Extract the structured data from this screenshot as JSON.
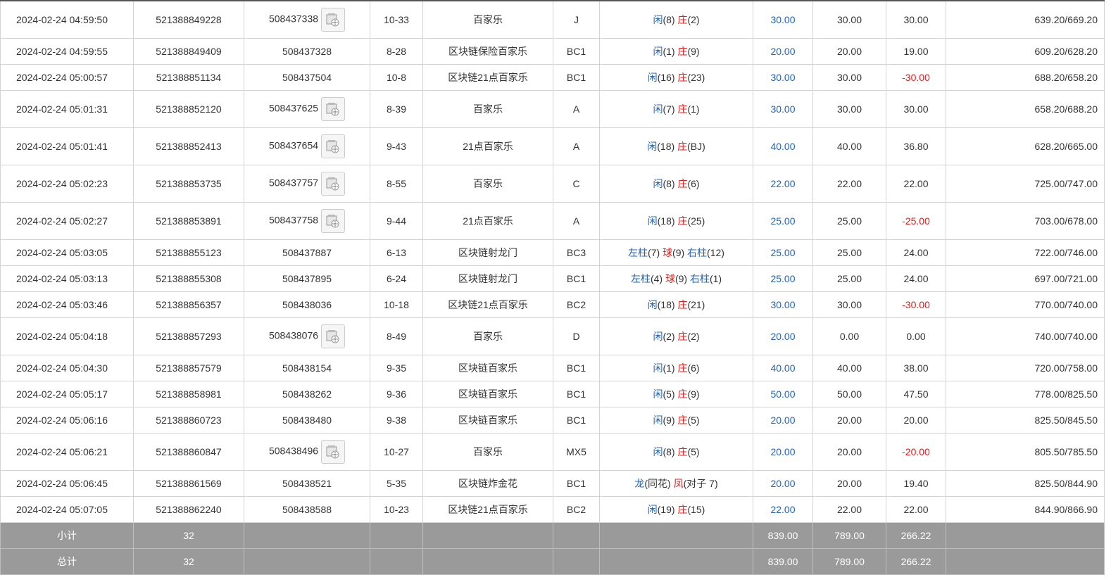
{
  "rows": [
    {
      "time": "2024-02-24 04:59:50",
      "bet_id": "521388849228",
      "round_id": "508437338",
      "video": true,
      "shoe": "10-33",
      "game": "百家乐",
      "table": "J",
      "result": [
        {
          "t": "闲",
          "c": "blue"
        },
        {
          "t": "(8) ",
          "c": ""
        },
        {
          "t": "庄",
          "c": "red"
        },
        {
          "t": "(2)",
          "c": ""
        }
      ],
      "bet": "30.00",
      "valid": "30.00",
      "win": "30.00",
      "win_neg": false,
      "balance": "639.20/669.20"
    },
    {
      "time": "2024-02-24 04:59:55",
      "bet_id": "521388849409",
      "round_id": "508437328",
      "video": false,
      "shoe": "8-28",
      "game": "区块链保险百家乐",
      "table": "BC1",
      "result": [
        {
          "t": "闲",
          "c": "blue"
        },
        {
          "t": "(1) ",
          "c": ""
        },
        {
          "t": "庄",
          "c": "red"
        },
        {
          "t": "(9)",
          "c": ""
        }
      ],
      "bet": "20.00",
      "valid": "20.00",
      "win": "19.00",
      "win_neg": false,
      "balance": "609.20/628.20"
    },
    {
      "time": "2024-02-24 05:00:57",
      "bet_id": "521388851134",
      "round_id": "508437504",
      "video": false,
      "shoe": "10-8",
      "game": "区块链21点百家乐",
      "table": "BC1",
      "result": [
        {
          "t": "闲",
          "c": "blue"
        },
        {
          "t": "(16) ",
          "c": ""
        },
        {
          "t": "庄",
          "c": "red"
        },
        {
          "t": "(23)",
          "c": ""
        }
      ],
      "bet": "30.00",
      "valid": "30.00",
      "win": "-30.00",
      "win_neg": true,
      "balance": "688.20/658.20"
    },
    {
      "time": "2024-02-24 05:01:31",
      "bet_id": "521388852120",
      "round_id": "508437625",
      "video": true,
      "shoe": "8-39",
      "game": "百家乐",
      "table": "A",
      "result": [
        {
          "t": "闲",
          "c": "blue"
        },
        {
          "t": "(7) ",
          "c": ""
        },
        {
          "t": "庄",
          "c": "red"
        },
        {
          "t": "(1)",
          "c": ""
        }
      ],
      "bet": "30.00",
      "valid": "30.00",
      "win": "30.00",
      "win_neg": false,
      "balance": "658.20/688.20"
    },
    {
      "time": "2024-02-24 05:01:41",
      "bet_id": "521388852413",
      "round_id": "508437654",
      "video": true,
      "shoe": "9-43",
      "game": "21点百家乐",
      "table": "A",
      "result": [
        {
          "t": "闲",
          "c": "blue"
        },
        {
          "t": "(18) ",
          "c": ""
        },
        {
          "t": "庄",
          "c": "red"
        },
        {
          "t": "(BJ)",
          "c": ""
        }
      ],
      "bet": "40.00",
      "valid": "40.00",
      "win": "36.80",
      "win_neg": false,
      "balance": "628.20/665.00"
    },
    {
      "time": "2024-02-24 05:02:23",
      "bet_id": "521388853735",
      "round_id": "508437757",
      "video": true,
      "shoe": "8-55",
      "game": "百家乐",
      "table": "C",
      "result": [
        {
          "t": "闲",
          "c": "blue"
        },
        {
          "t": "(8) ",
          "c": ""
        },
        {
          "t": "庄",
          "c": "red"
        },
        {
          "t": "(6)",
          "c": ""
        }
      ],
      "bet": "22.00",
      "valid": "22.00",
      "win": "22.00",
      "win_neg": false,
      "balance": "725.00/747.00"
    },
    {
      "time": "2024-02-24 05:02:27",
      "bet_id": "521388853891",
      "round_id": "508437758",
      "video": true,
      "shoe": "9-44",
      "game": "21点百家乐",
      "table": "A",
      "result": [
        {
          "t": "闲",
          "c": "blue"
        },
        {
          "t": "(18) ",
          "c": ""
        },
        {
          "t": "庄",
          "c": "red"
        },
        {
          "t": "(25)",
          "c": ""
        }
      ],
      "bet": "25.00",
      "valid": "25.00",
      "win": "-25.00",
      "win_neg": true,
      "balance": "703.00/678.00"
    },
    {
      "time": "2024-02-24 05:03:05",
      "bet_id": "521388855123",
      "round_id": "508437887",
      "video": false,
      "shoe": "6-13",
      "game": "区块链射龙门",
      "table": "BC3",
      "result": [
        {
          "t": "左柱",
          "c": "blue"
        },
        {
          "t": "(7) ",
          "c": ""
        },
        {
          "t": "球",
          "c": "red"
        },
        {
          "t": "(9) ",
          "c": ""
        },
        {
          "t": "右柱",
          "c": "blue"
        },
        {
          "t": "(12)",
          "c": ""
        }
      ],
      "bet": "25.00",
      "valid": "25.00",
      "win": "24.00",
      "win_neg": false,
      "balance": "722.00/746.00"
    },
    {
      "time": "2024-02-24 05:03:13",
      "bet_id": "521388855308",
      "round_id": "508437895",
      "video": false,
      "shoe": "6-24",
      "game": "区块链射龙门",
      "table": "BC1",
      "result": [
        {
          "t": "左柱",
          "c": "blue"
        },
        {
          "t": "(4) ",
          "c": ""
        },
        {
          "t": "球",
          "c": "red"
        },
        {
          "t": "(9) ",
          "c": ""
        },
        {
          "t": "右柱",
          "c": "blue"
        },
        {
          "t": "(1)",
          "c": ""
        }
      ],
      "bet": "25.00",
      "valid": "25.00",
      "win": "24.00",
      "win_neg": false,
      "balance": "697.00/721.00"
    },
    {
      "time": "2024-02-24 05:03:46",
      "bet_id": "521388856357",
      "round_id": "508438036",
      "video": false,
      "shoe": "10-18",
      "game": "区块链21点百家乐",
      "table": "BC2",
      "result": [
        {
          "t": "闲",
          "c": "blue"
        },
        {
          "t": "(18) ",
          "c": ""
        },
        {
          "t": "庄",
          "c": "red"
        },
        {
          "t": "(21)",
          "c": ""
        }
      ],
      "bet": "30.00",
      "valid": "30.00",
      "win": "-30.00",
      "win_neg": true,
      "balance": "770.00/740.00"
    },
    {
      "time": "2024-02-24 05:04:18",
      "bet_id": "521388857293",
      "round_id": "508438076",
      "video": true,
      "shoe": "8-49",
      "game": "百家乐",
      "table": "D",
      "result": [
        {
          "t": "闲",
          "c": "blue"
        },
        {
          "t": "(2) ",
          "c": ""
        },
        {
          "t": "庄",
          "c": "red"
        },
        {
          "t": "(2)",
          "c": ""
        }
      ],
      "bet": "20.00",
      "valid": "0.00",
      "win": "0.00",
      "win_neg": false,
      "balance": "740.00/740.00"
    },
    {
      "time": "2024-02-24 05:04:30",
      "bet_id": "521388857579",
      "round_id": "508438154",
      "video": false,
      "shoe": "9-35",
      "game": "区块链百家乐",
      "table": "BC1",
      "result": [
        {
          "t": "闲",
          "c": "blue"
        },
        {
          "t": "(1) ",
          "c": ""
        },
        {
          "t": "庄",
          "c": "red"
        },
        {
          "t": "(6)",
          "c": ""
        }
      ],
      "bet": "40.00",
      "valid": "40.00",
      "win": "38.00",
      "win_neg": false,
      "balance": "720.00/758.00"
    },
    {
      "time": "2024-02-24 05:05:17",
      "bet_id": "521388858981",
      "round_id": "508438262",
      "video": false,
      "shoe": "9-36",
      "game": "区块链百家乐",
      "table": "BC1",
      "result": [
        {
          "t": "闲",
          "c": "blue"
        },
        {
          "t": "(5) ",
          "c": ""
        },
        {
          "t": "庄",
          "c": "red"
        },
        {
          "t": "(9)",
          "c": ""
        }
      ],
      "bet": "50.00",
      "valid": "50.00",
      "win": "47.50",
      "win_neg": false,
      "balance": "778.00/825.50"
    },
    {
      "time": "2024-02-24 05:06:16",
      "bet_id": "521388860723",
      "round_id": "508438480",
      "video": false,
      "shoe": "9-38",
      "game": "区块链百家乐",
      "table": "BC1",
      "result": [
        {
          "t": "闲",
          "c": "blue"
        },
        {
          "t": "(9) ",
          "c": ""
        },
        {
          "t": "庄",
          "c": "red"
        },
        {
          "t": "(5)",
          "c": ""
        }
      ],
      "bet": "20.00",
      "valid": "20.00",
      "win": "20.00",
      "win_neg": false,
      "balance": "825.50/845.50"
    },
    {
      "time": "2024-02-24 05:06:21",
      "bet_id": "521388860847",
      "round_id": "508438496",
      "video": true,
      "shoe": "10-27",
      "game": "百家乐",
      "table": "MX5",
      "result": [
        {
          "t": "闲",
          "c": "blue"
        },
        {
          "t": "(8) ",
          "c": ""
        },
        {
          "t": "庄",
          "c": "red"
        },
        {
          "t": "(5)",
          "c": ""
        }
      ],
      "bet": "20.00",
      "valid": "20.00",
      "win": "-20.00",
      "win_neg": true,
      "balance": "805.50/785.50"
    },
    {
      "time": "2024-02-24 05:06:45",
      "bet_id": "521388861569",
      "round_id": "508438521",
      "video": false,
      "shoe": "5-35",
      "game": "区块链炸金花",
      "table": "BC1",
      "result": [
        {
          "t": "龙",
          "c": "blue"
        },
        {
          "t": "(同花) ",
          "c": ""
        },
        {
          "t": "凤",
          "c": "red"
        },
        {
          "t": "(对子 7)",
          "c": ""
        }
      ],
      "bet": "20.00",
      "valid": "20.00",
      "win": "19.40",
      "win_neg": false,
      "balance": "825.50/844.90"
    },
    {
      "time": "2024-02-24 05:07:05",
      "bet_id": "521388862240",
      "round_id": "508438588",
      "video": false,
      "shoe": "10-23",
      "game": "区块链21点百家乐",
      "table": "BC2",
      "result": [
        {
          "t": "闲",
          "c": "blue"
        },
        {
          "t": "(19) ",
          "c": ""
        },
        {
          "t": "庄",
          "c": "red"
        },
        {
          "t": "(15)",
          "c": ""
        }
      ],
      "bet": "22.00",
      "valid": "22.00",
      "win": "22.00",
      "win_neg": false,
      "balance": "844.90/866.90"
    }
  ],
  "summary": [
    {
      "label": "小计",
      "count": "32",
      "bet": "839.00",
      "valid": "789.00",
      "win": "266.22"
    },
    {
      "label": "总计",
      "count": "32",
      "bet": "839.00",
      "valid": "789.00",
      "win": "266.22"
    }
  ],
  "icons": {
    "video": "video-playback-icon"
  },
  "colors": {
    "blue": "#2163b5",
    "red": "#dd1f1f",
    "summary_bg": "#9a9a9a"
  }
}
